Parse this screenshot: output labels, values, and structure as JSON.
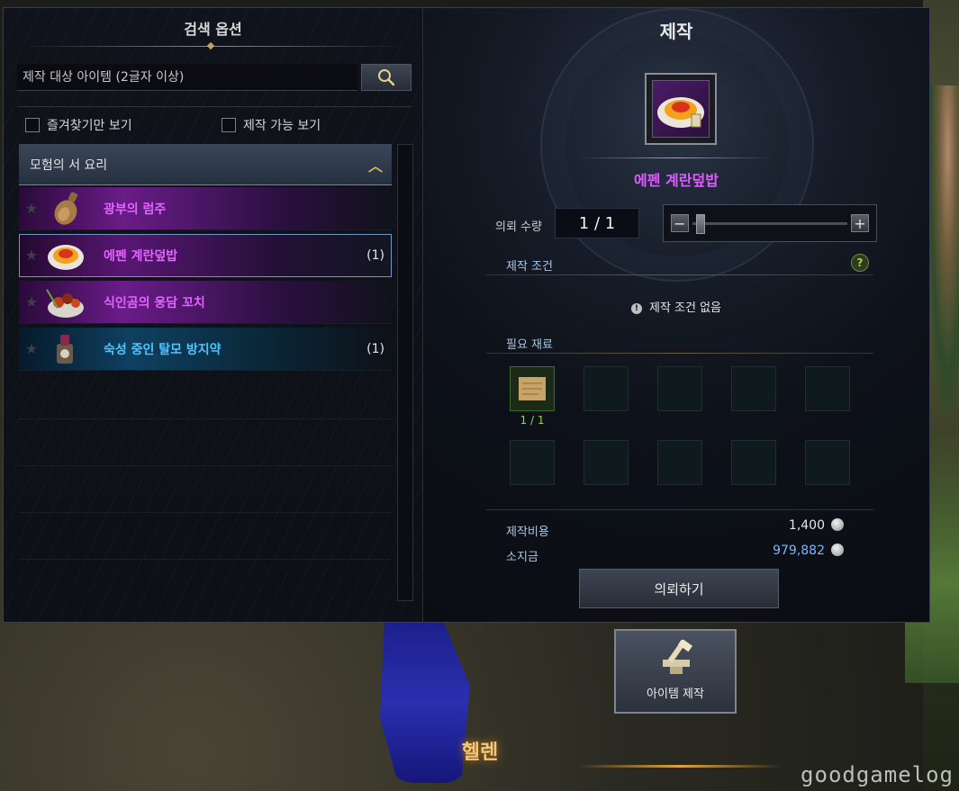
{
  "left_panel": {
    "title": "검색 옵션",
    "search": {
      "placeholder": "제작 대상 아이템 (2글자 이상)",
      "value": ""
    },
    "filters": [
      {
        "label": "즐겨찾기만 보기",
        "checked": false
      },
      {
        "label": "제작 가능 보기",
        "checked": false
      }
    ],
    "category": {
      "label": "모험의 서 요리",
      "expanded": true
    },
    "items": [
      {
        "name": "광부의 럼주",
        "count": "",
        "grade": "purple",
        "icon": "rum-bottle-icon",
        "selected": false
      },
      {
        "name": "에펜 계란덮밥",
        "count": "(1)",
        "grade": "purple",
        "icon": "egg-rice-icon",
        "selected": true
      },
      {
        "name": "식인곰의 웅담 꼬치",
        "count": "",
        "grade": "purple",
        "icon": "skewer-icon",
        "selected": false
      },
      {
        "name": "숙성 중인 탈모 방지약",
        "count": "(1)",
        "grade": "blue",
        "icon": "potion-icon",
        "selected": false
      }
    ]
  },
  "right_panel": {
    "title": "제작",
    "item_name": "에펜 계란덮밥",
    "quantity": {
      "label": "의뢰 수량",
      "value": "1 / 1",
      "slider_fraction": 0.0
    },
    "conditions": {
      "label": "제작 조건",
      "help": "?",
      "text": "제작 조건 없음",
      "info": "!"
    },
    "materials": {
      "label": "필요 재료",
      "slots": [
        {
          "filled": true,
          "icon": "scroll-icon",
          "count": "1 / 1"
        },
        {
          "filled": false
        },
        {
          "filled": false
        },
        {
          "filled": false
        },
        {
          "filled": false
        },
        {
          "filled": false
        },
        {
          "filled": false
        },
        {
          "filled": false
        },
        {
          "filled": false
        },
        {
          "filled": false
        }
      ]
    },
    "cost": {
      "label": "제작비용",
      "value": "1,400",
      "color": "#e6e6e6"
    },
    "money": {
      "label": "소지금",
      "value": "979,882",
      "color": "#7eb6ff"
    },
    "request_button": "의뢰하기"
  },
  "craft_button": {
    "label": "아이템 제작",
    "icon": "anvil-hammer-icon"
  },
  "npc_name": "헬렌",
  "watermark": "goodgamelog",
  "colors": {
    "purple_text": "#e263ff",
    "blue_text": "#49c6ff",
    "accent_gold": "#c8a262",
    "label_blue": "#a8c6e8"
  }
}
